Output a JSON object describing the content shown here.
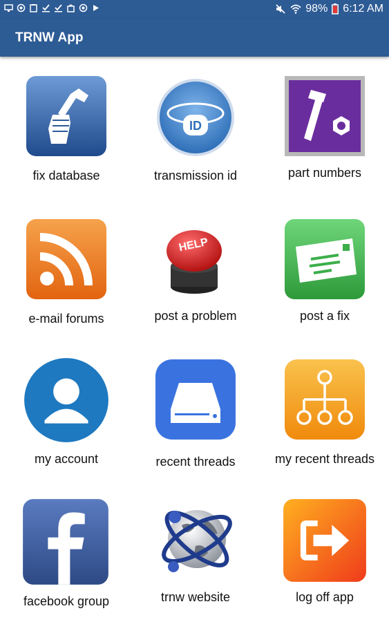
{
  "status_bar": {
    "battery": "98%",
    "time": "6:12 AM",
    "icons_left": [
      "screen-icon",
      "camera-icon",
      "clipboard-icon",
      "check-icon",
      "check-icon",
      "bag-icon",
      "camera-icon",
      "play-icon"
    ],
    "icons_right": [
      "mute-icon",
      "wifi-icon",
      "battery-icon"
    ]
  },
  "app_bar": {
    "title": "TRNW App"
  },
  "tiles": [
    {
      "label": "fix database",
      "icon": "wrench-fist-icon"
    },
    {
      "label": "transmission id",
      "icon": "id-band-icon"
    },
    {
      "label": "part numbers",
      "icon": "bolt-nut-icon"
    },
    {
      "label": "e-mail forums",
      "icon": "rss-icon"
    },
    {
      "label": "post a problem",
      "icon": "help-button-icon"
    },
    {
      "label": "post a fix",
      "icon": "envelope-icon"
    },
    {
      "label": "my account",
      "icon": "user-icon"
    },
    {
      "label": "recent threads",
      "icon": "drive-icon"
    },
    {
      "label": "my recent threads",
      "icon": "hierarchy-icon"
    },
    {
      "label": "facebook group",
      "icon": "facebook-icon"
    },
    {
      "label": "trnw website",
      "icon": "globe-icon"
    },
    {
      "label": "log off app",
      "icon": "logout-icon"
    }
  ],
  "colors": {
    "bar": "#2d5b94",
    "fix_database": "#2d5a9a",
    "part_numbers": "#6a2d9e",
    "email_forums": "#f07b1c",
    "post_a_fix": "#3cae4a",
    "my_account": "#1e79c0",
    "recent_threads": "#3a73e0",
    "my_recent_threads": "#f39c12",
    "facebook": "#3b5b9b",
    "log_off": "#f2551b"
  }
}
